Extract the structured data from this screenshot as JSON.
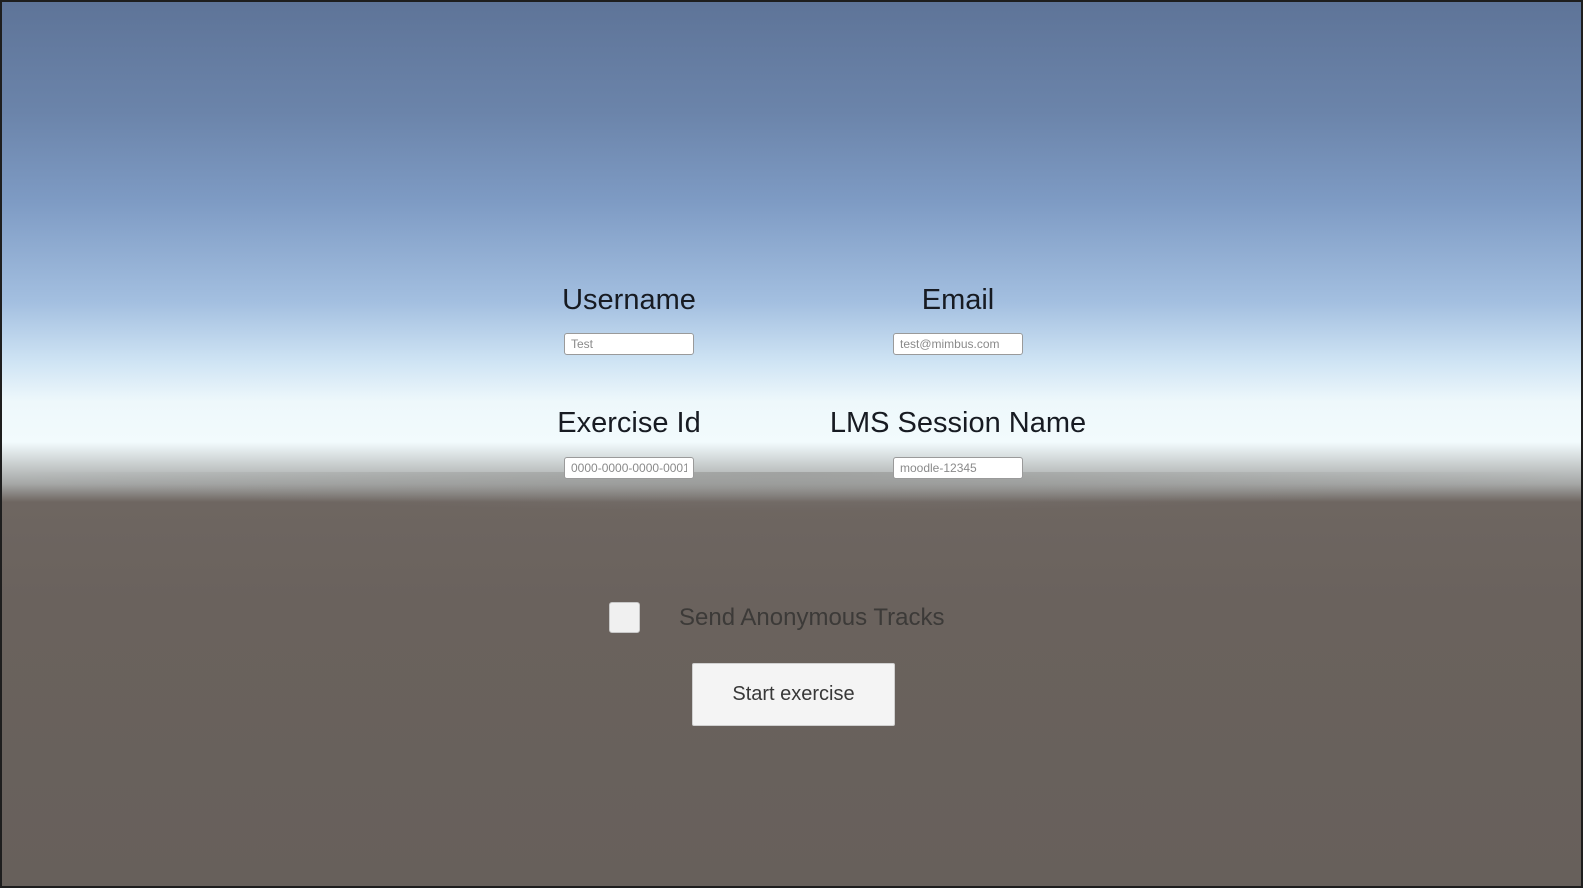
{
  "form": {
    "username": {
      "label": "Username",
      "placeholder": "Test"
    },
    "email": {
      "label": "Email",
      "placeholder": "test@mimbus.com"
    },
    "exercise_id": {
      "label": "Exercise Id",
      "placeholder": "0000-0000-0000-0001"
    },
    "lms_session_name": {
      "label": "LMS Session Name",
      "placeholder": "moodle-12345"
    },
    "anonymous_tracks": {
      "label": "Send Anonymous Tracks",
      "checked": false
    },
    "start_button": {
      "label": "Start exercise"
    }
  },
  "colors": {
    "sky_top": "#5e7498",
    "horizon": "#f2fbfd",
    "ground": "#67605b",
    "label_text": "#171b22",
    "button_bg": "#f4f4f4"
  }
}
